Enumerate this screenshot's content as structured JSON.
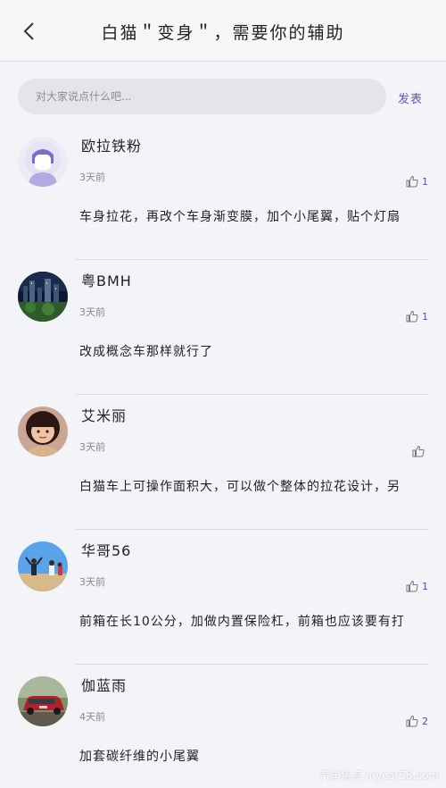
{
  "header": {
    "title": "白猫＂变身＂，需要你的辅助",
    "back_icon": "chevron-left-icon"
  },
  "composer": {
    "placeholder": "对大家说点什么吧...",
    "publish_label": "发表"
  },
  "comments": [
    {
      "user": "欧拉铁粉",
      "time": "3天前",
      "likes": "1",
      "text": "车身拉花，再改个车身渐变膜，加个小尾翼，贴个灯扇"
    },
    {
      "user": "粤BMH",
      "time": "3天前",
      "likes": "1",
      "text": "改成概念车那样就行了"
    },
    {
      "user": "艾米丽",
      "time": "3天前",
      "likes": "",
      "text": "白猫车上可操作面积大，可以做个整体的拉花设计，另"
    },
    {
      "user": "华哥56",
      "time": "3天前",
      "likes": "1",
      "text": "前箱在长10公分，加做内置保险杠，前箱也应该要有打"
    },
    {
      "user": "伽蓝雨",
      "time": "4天前",
      "likes": "2",
      "text": "加套碳纤维的小尾翼"
    }
  ],
  "watermark": "汽车焦点 mycar58.com",
  "colors": {
    "accent": "#6a4fc9",
    "like_count": "#5a45c0",
    "background": "#f2f4f8"
  }
}
